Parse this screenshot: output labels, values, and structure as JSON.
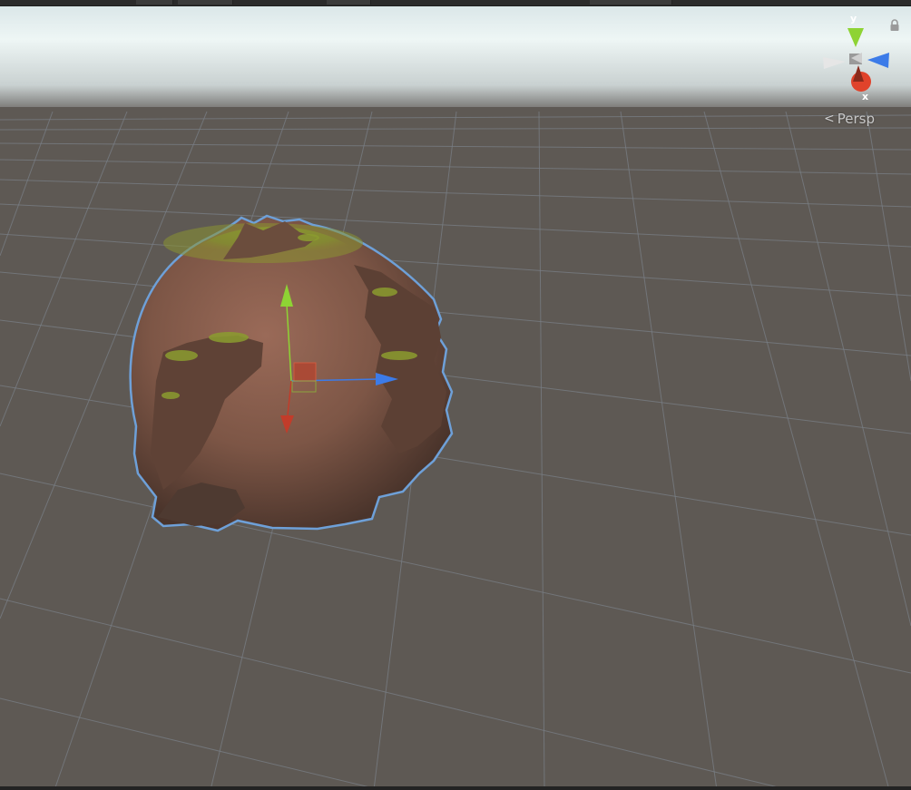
{
  "view": {
    "projection_label": "Persp"
  },
  "gizmo": {
    "axis_y_label": "y",
    "axis_x_label": "x",
    "colors": {
      "y": "#8ed334",
      "x": "#e0432b",
      "z": "#3c7be8",
      "neutral": "#d6d6d6"
    }
  },
  "transform_handle": {
    "colors": {
      "y": "#8ed334",
      "x": "#c23c2a",
      "z": "#3c7be8"
    }
  },
  "scene": {
    "sky_top": "#ffffff",
    "sky_horizon": "#b9c4c6",
    "ground": "#5e5954",
    "grid_line": "#7a7f86"
  },
  "icons": {
    "lock": "lock-icon",
    "persp_arrow": "chevron-left-icon"
  }
}
